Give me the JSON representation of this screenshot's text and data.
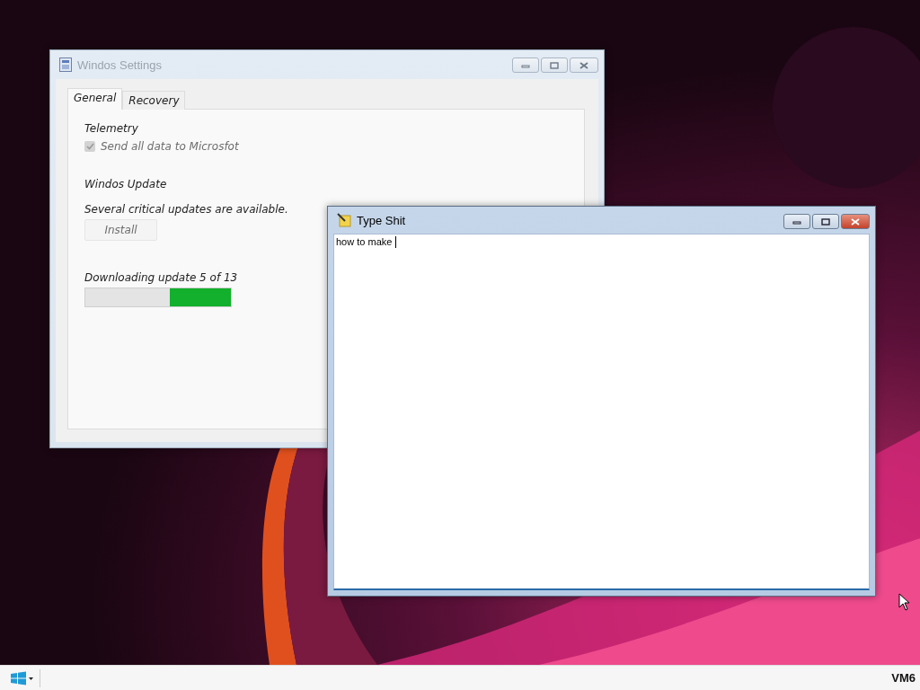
{
  "settings_window": {
    "title": "Windos Settings",
    "active": false,
    "tabs": [
      {
        "label": "General",
        "selected": true
      },
      {
        "label": "Recovery",
        "selected": false
      }
    ],
    "telemetry": {
      "heading": "Telemetry",
      "checkbox": {
        "label": "Send all data to Microsfot",
        "checked": true,
        "disabled": true
      }
    },
    "update": {
      "heading": "Windos Update",
      "message": "Several critical updates are available.",
      "button": {
        "label": "Install",
        "disabled": true
      },
      "progress_label": "Downloading update 5 of 13",
      "progress": {
        "level": 0.42
      }
    }
  },
  "editor_window": {
    "title": "Type Shit",
    "active": true,
    "text": "how to make"
  },
  "taskbar": {
    "label": "VM6"
  }
}
